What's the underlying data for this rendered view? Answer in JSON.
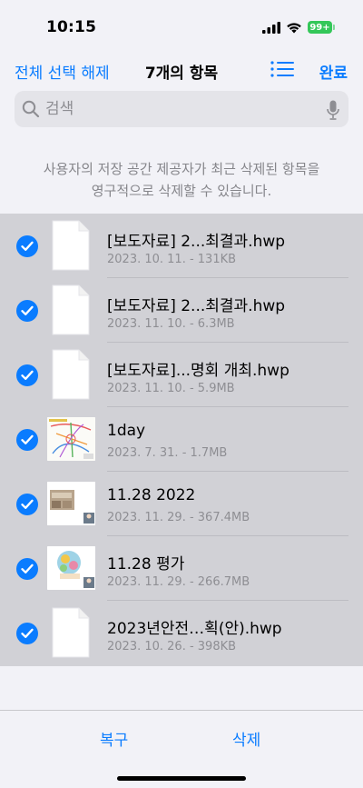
{
  "status": {
    "time": "10:15",
    "battery": "99+"
  },
  "nav": {
    "select_all_label": "전체 선택 해제",
    "title": "7개의 항목",
    "done_label": "완료"
  },
  "search": {
    "placeholder": "검색"
  },
  "notice": {
    "line1": "사용자의 저장 공간 제공자가 최근 삭제된 항목을",
    "line2": "영구적으로 삭제할 수 있습니다."
  },
  "files": [
    {
      "name": "[보도자료] 2...최결과.hwp",
      "meta": "2023. 10. 11. - 131KB",
      "icon": "document-icon",
      "selected": true
    },
    {
      "name": "[보도자료] 2...최결과.hwp",
      "meta": "2023. 11. 10. - 6.3MB",
      "icon": "document-icon",
      "selected": true
    },
    {
      "name": "[보도자료]...명회 개최.hwp",
      "meta": "2023. 11. 10. - 5.9MB",
      "icon": "document-icon",
      "selected": true
    },
    {
      "name": "1day",
      "meta": "2023. 7. 31. - 1.7MB",
      "icon": "map-thumbnail",
      "selected": true
    },
    {
      "name": "11.28 2022",
      "meta": "2023. 11. 29. - 367.4MB",
      "icon": "photo-thumbnail",
      "selected": true
    },
    {
      "name": "11.28 평가",
      "meta": "2023. 11. 29. - 266.7MB",
      "icon": "image-thumbnail",
      "selected": true
    },
    {
      "name": "2023년안전…획(안).hwp",
      "meta": "2023. 10. 26. - 398KB",
      "icon": "document-icon",
      "selected": true
    }
  ],
  "toolbar": {
    "recover_label": "복구",
    "delete_label": "삭제"
  },
  "colors": {
    "accent": "#0a7cff",
    "selected_bg": "#d1d1d6",
    "battery": "#34c759"
  }
}
